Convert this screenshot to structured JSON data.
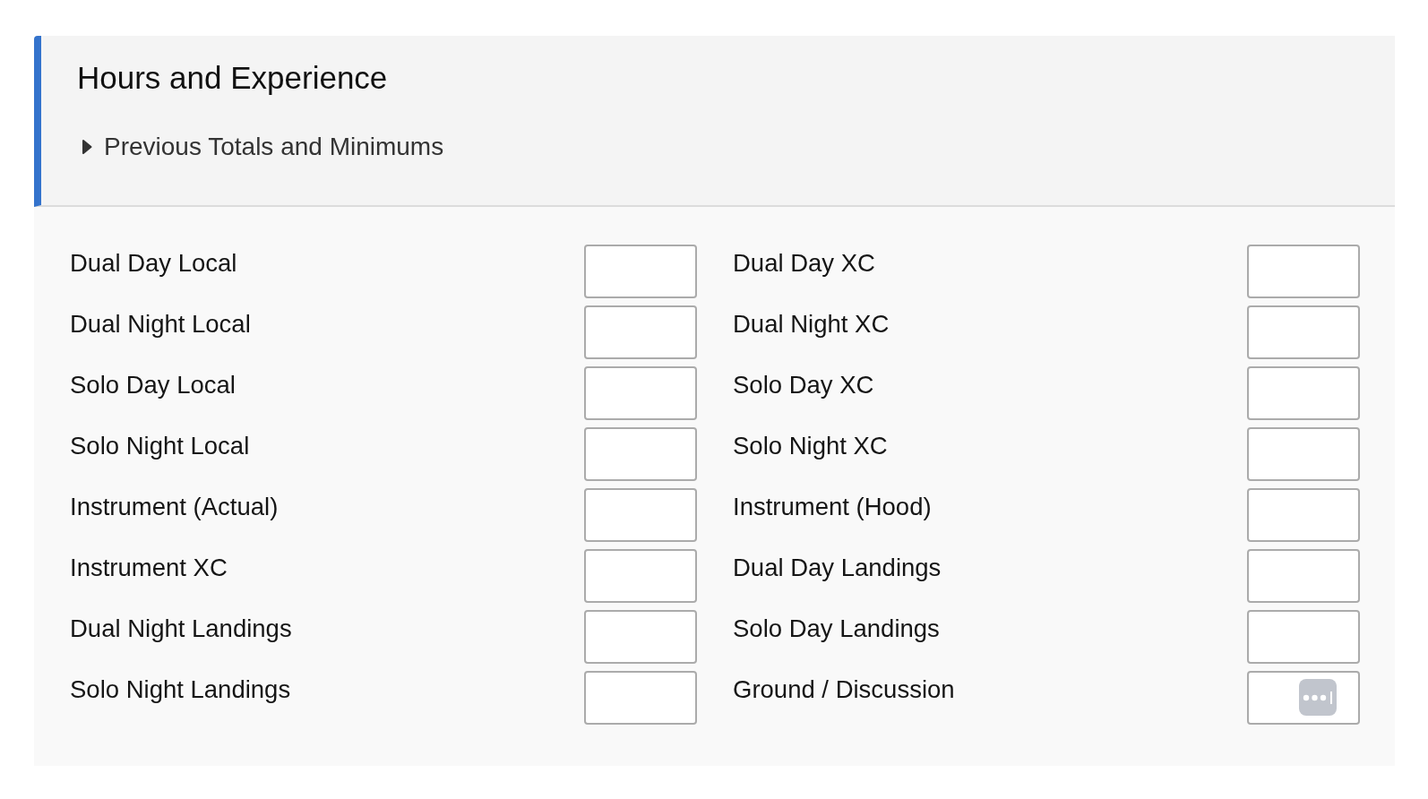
{
  "section": {
    "title": "Hours and Experience",
    "disclosure": {
      "label": "Previous Totals and Minimums",
      "expanded": false
    },
    "fields": [
      {
        "label": "Dual Day Local",
        "autofill_badge": false
      },
      {
        "label": "Dual Day XC",
        "autofill_badge": false
      },
      {
        "label": "Dual Night Local",
        "autofill_badge": false
      },
      {
        "label": "Dual Night XC",
        "autofill_badge": false
      },
      {
        "label": "Solo Day Local",
        "autofill_badge": false
      },
      {
        "label": "Solo Day XC",
        "autofill_badge": false
      },
      {
        "label": "Solo Night Local",
        "autofill_badge": false
      },
      {
        "label": "Solo Night XC",
        "autofill_badge": false
      },
      {
        "label": "Instrument (Actual)",
        "autofill_badge": false
      },
      {
        "label": "Instrument (Hood)",
        "autofill_badge": false
      },
      {
        "label": "Instrument XC",
        "autofill_badge": false
      },
      {
        "label": "Dual Day Landings",
        "autofill_badge": false
      },
      {
        "label": "Dual Night Landings",
        "autofill_badge": false
      },
      {
        "label": "Solo Day Landings",
        "autofill_badge": false
      },
      {
        "label": "Solo Night Landings",
        "autofill_badge": false
      },
      {
        "label": "Ground / Discussion",
        "autofill_badge": true
      }
    ]
  }
}
